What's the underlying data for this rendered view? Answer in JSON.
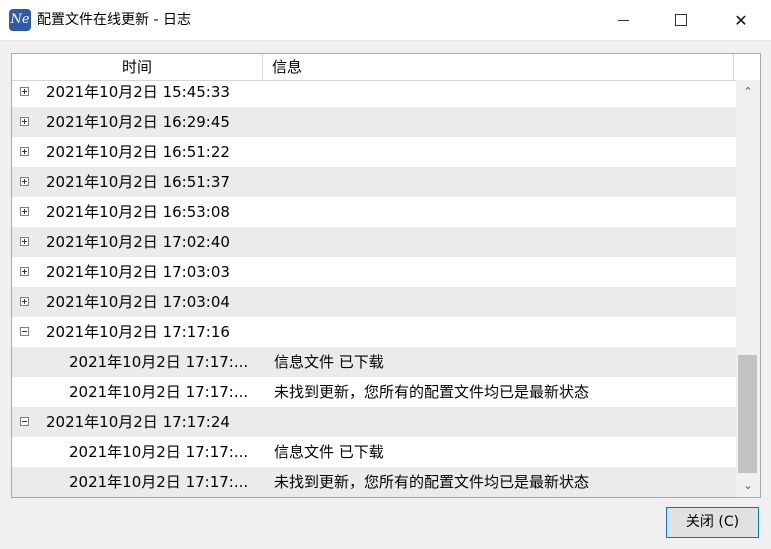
{
  "window": {
    "title": "配置文件在线更新 - 日志",
    "icon_text": "Ne"
  },
  "columns": {
    "time": "时间",
    "info": "信息"
  },
  "rows": [
    {
      "time": "2021年10月2日 15:45:33",
      "msg": "",
      "state": "collapsed"
    },
    {
      "time": "2021年10月2日 16:29:45",
      "msg": "",
      "state": "collapsed"
    },
    {
      "time": "2021年10月2日 16:51:22",
      "msg": "",
      "state": "collapsed"
    },
    {
      "time": "2021年10月2日 16:51:37",
      "msg": "",
      "state": "collapsed"
    },
    {
      "time": "2021年10月2日 16:53:08",
      "msg": "",
      "state": "collapsed"
    },
    {
      "time": "2021年10月2日 17:02:40",
      "msg": "",
      "state": "collapsed"
    },
    {
      "time": "2021年10月2日 17:03:03",
      "msg": "",
      "state": "collapsed"
    },
    {
      "time": "2021年10月2日 17:03:04",
      "msg": "",
      "state": "collapsed"
    },
    {
      "time": "2021年10月2日 17:17:16",
      "msg": "",
      "state": "expanded"
    },
    {
      "time": "2021年10月2日 17:17:...",
      "msg": "信息文件 已下载",
      "state": "child"
    },
    {
      "time": "2021年10月2日 17:17:...",
      "msg": "未找到更新，您所有的配置文件均已是最新状态",
      "state": "child"
    },
    {
      "time": "2021年10月2日 17:17:24",
      "msg": "",
      "state": "expanded"
    },
    {
      "time": "2021年10月2日 17:17:...",
      "msg": "信息文件 已下载",
      "state": "child"
    },
    {
      "time": "2021年10月2日 17:17:...",
      "msg": "未找到更新，您所有的配置文件均已是最新状态",
      "state": "child"
    }
  ],
  "buttons": {
    "close_label": "关闭 (C)"
  },
  "colors": {
    "accent": "#0078d7",
    "alt_row": "#ebebeb"
  }
}
